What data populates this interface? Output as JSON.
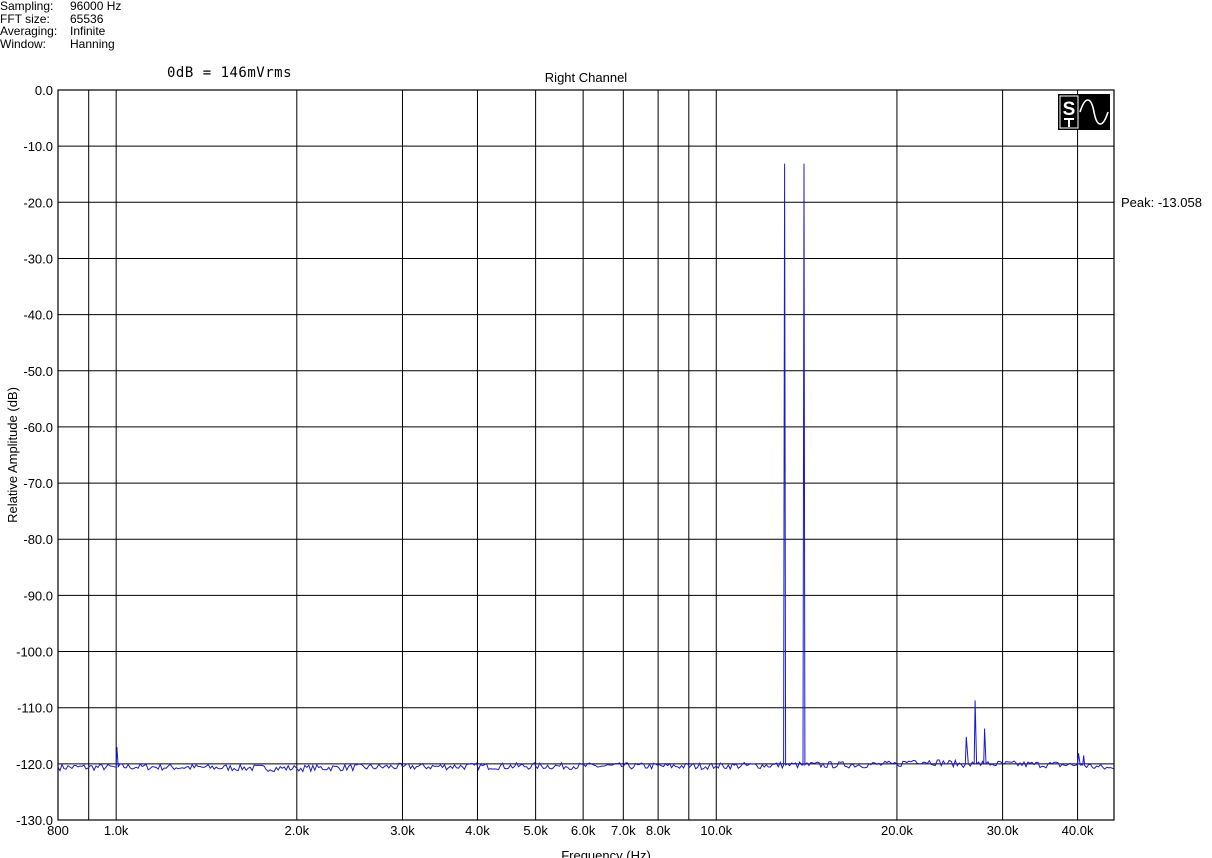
{
  "info": [
    {
      "key": "Sampling:",
      "value": "96000 Hz"
    },
    {
      "key": "FFT size:",
      "value": "65536"
    },
    {
      "key": "Averaging:",
      "value": "Infinite"
    },
    {
      "key": "Window:",
      "value": "Hanning"
    }
  ],
  "zero_db_ref": "0dB = 146mVrms",
  "peak_label": "Peak: -13.058",
  "logo_text": "S",
  "colors": {
    "trace": "#1a1ad0",
    "grid": "#000000",
    "background": "#ffffff"
  },
  "chart_data": {
    "type": "line",
    "title": "Right Channel",
    "xlabel": "Frequency (Hz)",
    "ylabel": "Relative Amplitude (dB)",
    "x_scale": "log",
    "xlim": [
      800,
      46000
    ],
    "ylim": [
      -130,
      0
    ],
    "grid": true,
    "x_ticks": [
      {
        "value": 800,
        "label": "800"
      },
      {
        "value": 1000,
        "label": "1.0k"
      },
      {
        "value": 2000,
        "label": "2.0k"
      },
      {
        "value": 3000,
        "label": "3.0k"
      },
      {
        "value": 4000,
        "label": "4.0k"
      },
      {
        "value": 5000,
        "label": "5.0k"
      },
      {
        "value": 6000,
        "label": "6.0k"
      },
      {
        "value": 7000,
        "label": "7.0k"
      },
      {
        "value": 8000,
        "label": "8.0k"
      },
      {
        "value": 10000,
        "label": "10.0k"
      },
      {
        "value": 20000,
        "label": "20.0k"
      },
      {
        "value": 30000,
        "label": "30.0k"
      },
      {
        "value": 40000,
        "label": "40.0k"
      }
    ],
    "x_minor_grid": [
      900,
      9000
    ],
    "y_ticks": [
      {
        "value": 0,
        "label": "0.0"
      },
      {
        "value": -10,
        "label": "-10.0"
      },
      {
        "value": -20,
        "label": "-20.0"
      },
      {
        "value": -30,
        "label": "-30.0"
      },
      {
        "value": -40,
        "label": "-40.0"
      },
      {
        "value": -50,
        "label": "-50.0"
      },
      {
        "value": -60,
        "label": "-60.0"
      },
      {
        "value": -70,
        "label": "-70.0"
      },
      {
        "value": -80,
        "label": "-80.0"
      },
      {
        "value": -90,
        "label": "-90.0"
      },
      {
        "value": -100,
        "label": "-100.0"
      },
      {
        "value": -110,
        "label": "-110.0"
      },
      {
        "value": -120,
        "label": "-120.0"
      },
      {
        "value": -130,
        "label": "-130.0"
      }
    ],
    "noise_floor_db": -120.7,
    "series": [
      {
        "points": [
          [
            800,
            -120.6
          ],
          [
            1000,
            -120.6
          ],
          [
            1003,
            -117.0
          ],
          [
            1008,
            -120.5
          ],
          [
            2000,
            -120.8
          ],
          [
            3000,
            -120.5
          ],
          [
            5000,
            -120.4
          ],
          [
            10000,
            -120.4
          ],
          [
            12950,
            -120.2
          ],
          [
            13000,
            -13.1
          ],
          [
            13050,
            -120.2
          ],
          [
            13950,
            -120.2
          ],
          [
            14000,
            -13.1
          ],
          [
            14050,
            -120.2
          ],
          [
            20000,
            -120.1
          ],
          [
            21300,
            -119.4
          ],
          [
            26000,
            -120.1
          ],
          [
            26100,
            -115.2
          ],
          [
            26300,
            -120.0
          ],
          [
            26900,
            -120.0
          ],
          [
            27000,
            -108.7
          ],
          [
            27150,
            -120.0
          ],
          [
            27900,
            -120.0
          ],
          [
            28000,
            -113.7
          ],
          [
            28150,
            -120.0
          ],
          [
            40000,
            -120.2
          ],
          [
            40150,
            -118.1
          ],
          [
            40400,
            -120.2
          ],
          [
            40800,
            -120.2
          ],
          [
            40950,
            -118.5
          ],
          [
            41100,
            -120.3
          ],
          [
            46000,
            -120.9
          ]
        ]
      }
    ]
  }
}
